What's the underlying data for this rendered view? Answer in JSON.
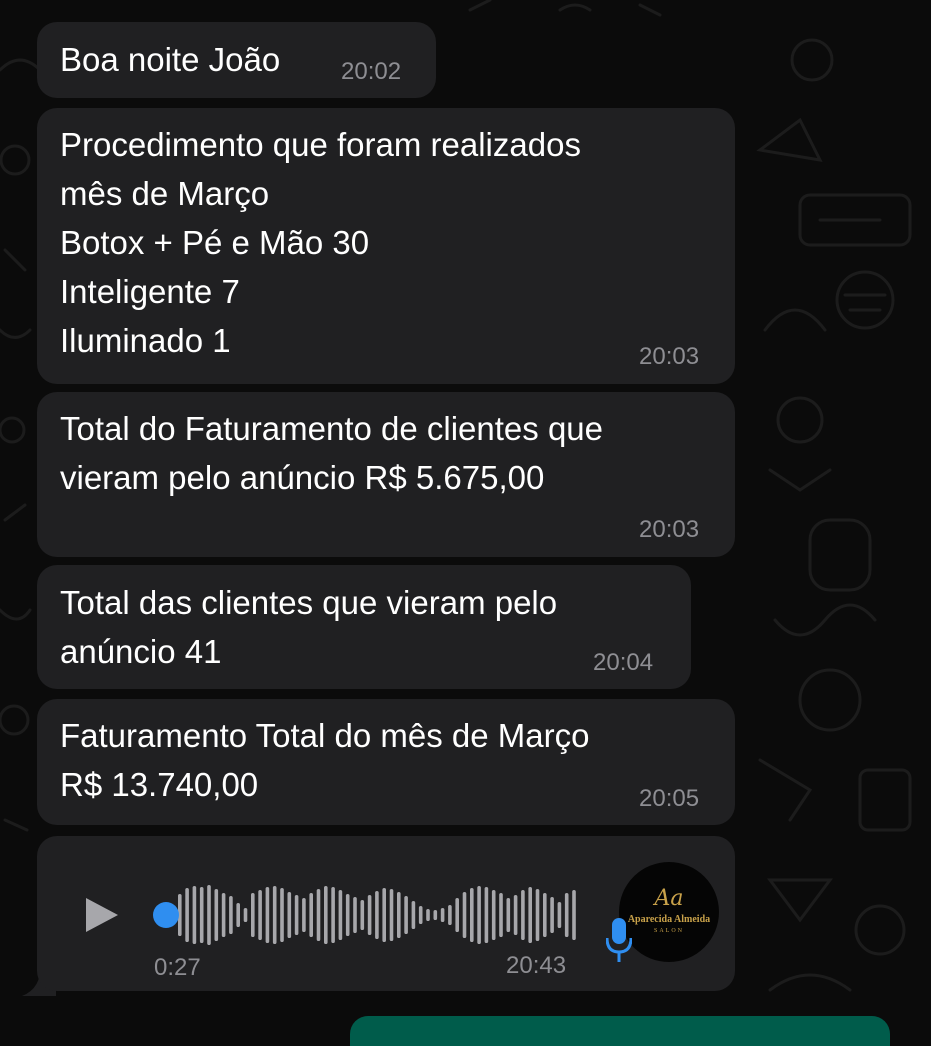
{
  "colors": {
    "background": "#0b0b0b",
    "incoming_bubble": "#202022",
    "message_text": "#ffffff",
    "timestamp": "#8e8e93",
    "voice_accent": "#2f8ef0",
    "outgoing_bubble": "#005c4b",
    "logo_gold": "#c9a24a"
  },
  "messages": [
    {
      "lines": [
        "Boa noite João"
      ],
      "time": "20:02"
    },
    {
      "lines": [
        "Procedimento que foram realizados",
        "mês de Março",
        "Botox + Pé e Mão 30",
        "Inteligente 7",
        "Iluminado 1"
      ],
      "time": "20:03"
    },
    {
      "lines": [
        "Total do Faturamento de clientes que",
        "vieram pelo anúncio R$ 5.675,00"
      ],
      "time": "20:03"
    },
    {
      "lines": [
        "Total das clientes que vieram pelo",
        "anúncio 41"
      ],
      "time": "20:04"
    },
    {
      "lines": [
        "Faturamento Total do mês de Março",
        "R$ 13.740,00"
      ],
      "time": "20:05"
    }
  ],
  "voice_message": {
    "play_icon": "play-icon",
    "duration": "0:27",
    "time": "20:43",
    "progress": 0,
    "mic_icon": "microphone-icon",
    "avatar": {
      "monogram": "Aa",
      "name": "Aparecida Almeida",
      "subtitle": "SALON"
    }
  }
}
